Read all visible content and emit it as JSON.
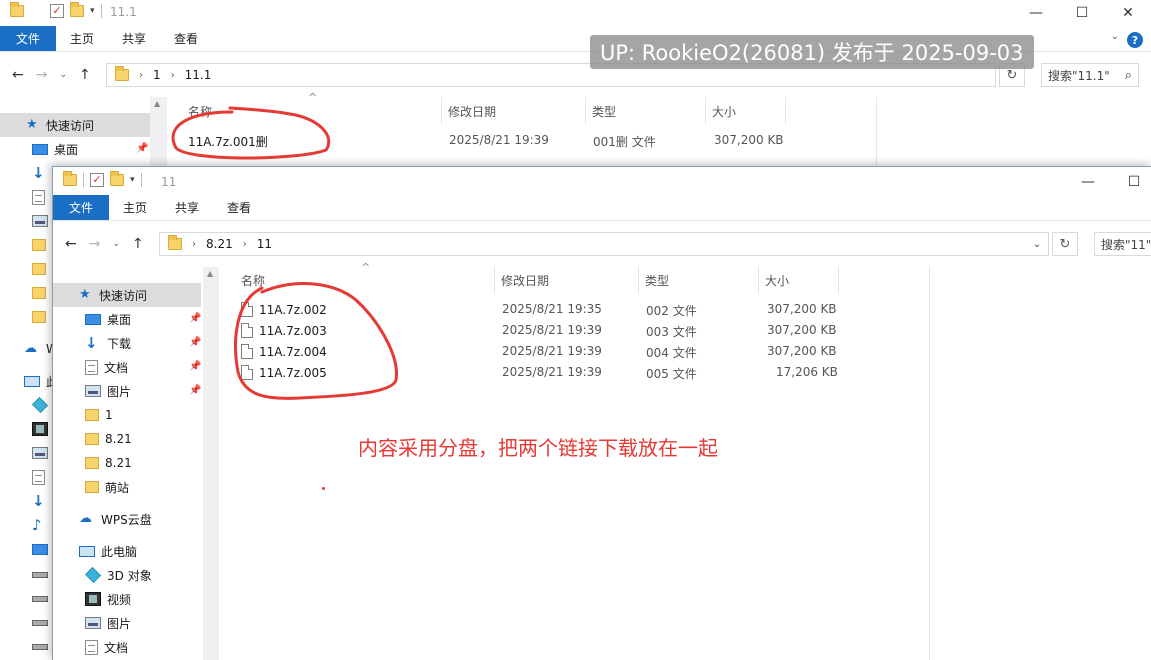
{
  "watermark": "UP: RookieO2(26081) 发布于 2025-09-03",
  "annotation": "内容采用分盘，把两个链接下载放在一起",
  "ribbon_tabs": {
    "file": "文件",
    "home": "主页",
    "share": "共享",
    "view": "查看"
  },
  "columns": {
    "name": "名称",
    "modified": "修改日期",
    "type": "类型",
    "size": "大小"
  },
  "back_window": {
    "title": "11.1",
    "breadcrumb": [
      "1",
      "11.1"
    ],
    "search_placeholder": "搜索\"11.1\"",
    "nav": {
      "quick_access": "快速访问",
      "desktop": "桌面"
    },
    "files": [
      {
        "name": "11A.7z.001删",
        "modified": "2025/8/21 19:39",
        "type": "001删 文件",
        "size": "307,200 KB"
      }
    ]
  },
  "front_window": {
    "title": "11",
    "breadcrumb": [
      "8.21",
      "11"
    ],
    "search_placeholder": "搜索\"11\"",
    "nav": {
      "quick_access": "快速访问",
      "desktop": "桌面",
      "downloads": "下载",
      "documents": "文档",
      "pictures": "图片",
      "folder_1": "1",
      "folder_821a": "8.21",
      "folder_821b": "8.21",
      "folder_mengzhan": "萌站",
      "wps": "WPS云盘",
      "this_pc": "此电脑",
      "objects3d": "3D 对象",
      "videos": "视频",
      "pictures2": "图片",
      "documents2": "文档"
    },
    "files": [
      {
        "name": "11A.7z.002",
        "modified": "2025/8/21 19:35",
        "type": "002 文件",
        "size": "307,200 KB"
      },
      {
        "name": "11A.7z.003",
        "modified": "2025/8/21 19:39",
        "type": "003 文件",
        "size": "307,200 KB"
      },
      {
        "name": "11A.7z.004",
        "modified": "2025/8/21 19:39",
        "type": "004 文件",
        "size": "307,200 KB"
      },
      {
        "name": "11A.7z.005",
        "modified": "2025/8/21 19:39",
        "type": "005 文件",
        "size": "17,206 KB"
      }
    ]
  },
  "colors": {
    "accent": "#1a6fc4",
    "annotation_red": "#e53935"
  }
}
